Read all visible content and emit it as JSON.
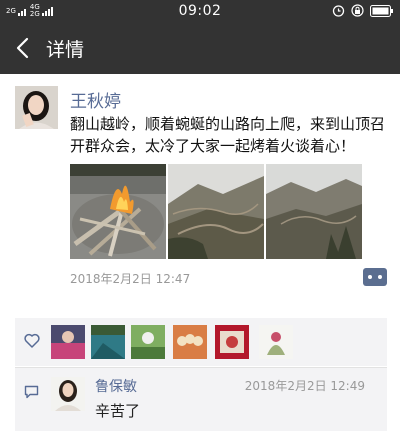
{
  "status_bar": {
    "signal1": "2G",
    "signal2_top": "4G",
    "signal2_bottom": "2G",
    "time": "09:02"
  },
  "header": {
    "title": "详情",
    "back_icon": "chevron-left-icon"
  },
  "post": {
    "author": "王秋婷",
    "content": "翻山越岭，顺着蜿蜒的山路向上爬，来到山顶召开群众会，太冷了大家一起烤着火谈着心！",
    "timestamp": "2018年2月2日 12:47",
    "photos": [
      "campfire-photo",
      "mountain-road-photo",
      "mountain-valley-photo"
    ]
  },
  "likes": {
    "icon": "heart-icon",
    "avatars": [
      "avatar-1",
      "avatar-2",
      "avatar-3",
      "avatar-4",
      "avatar-5",
      "avatar-6"
    ]
  },
  "comment": {
    "icon": "comment-icon",
    "name": "鲁保敏",
    "time": "2018年2月2日 12:49",
    "text": "辛苦了"
  },
  "colors": {
    "bar_bg": "#333333",
    "link": "#576b95",
    "panel_bg": "#f3f3f5"
  }
}
